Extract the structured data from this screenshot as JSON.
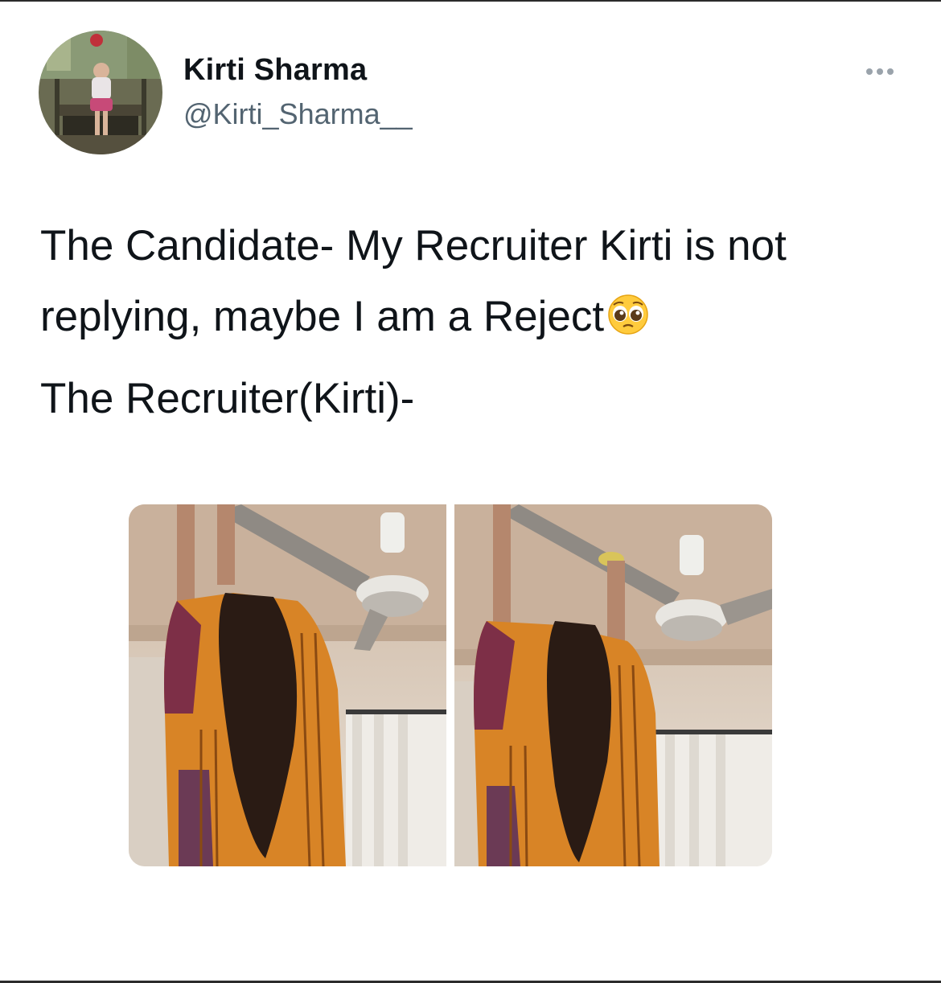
{
  "author": {
    "display_name": "Kirti Sharma",
    "handle": "@Kirti_Sharma__"
  },
  "tweet": {
    "line1": "The Candidate- My Recruiter Kirti is not replying, maybe I am a Reject",
    "line2": "The Recruiter(Kirti)-"
  },
  "emoji": "pleading-face",
  "icons": {
    "more": "more-options-icon"
  },
  "colors": {
    "text": "#0f1419",
    "secondary_text": "#536471",
    "dots": "#9aa3ab"
  }
}
